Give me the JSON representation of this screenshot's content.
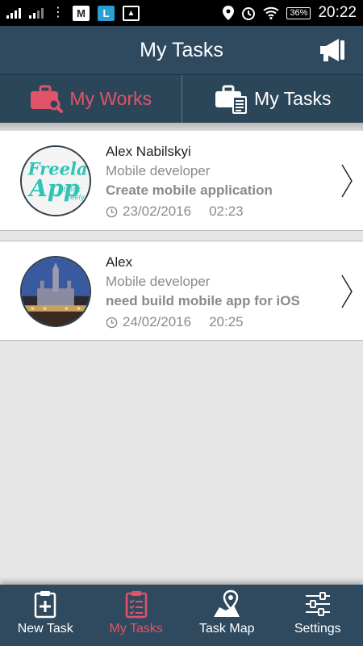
{
  "status_bar": {
    "battery": "36%",
    "time": "20:22"
  },
  "header": {
    "title": "My Tasks"
  },
  "tabs": [
    {
      "label": "My Works",
      "active": true
    },
    {
      "label": "My Tasks",
      "active": false
    }
  ],
  "tasks": [
    {
      "name": "Alex Nabilskyi",
      "role": "Mobile developer",
      "description": "Create mobile application",
      "date": "23/02/2016",
      "time": "02:23",
      "avatar_text": "Freelance App"
    },
    {
      "name": "Alex",
      "role": "Mobile developer",
      "description": "need build mobile app for iOS",
      "date": "24/02/2016",
      "time": "20:25"
    }
  ],
  "bottom_nav": [
    {
      "label": "New Task",
      "icon": "clipboard-plus-icon",
      "active": false
    },
    {
      "label": "My Tasks",
      "icon": "clipboard-list-icon",
      "active": true
    },
    {
      "label": "Task Map",
      "icon": "map-pin-icon",
      "active": false
    },
    {
      "label": "Settings",
      "icon": "sliders-icon",
      "active": false
    }
  ],
  "colors": {
    "header_bg": "#2f4a5f",
    "accent": "#e0536a",
    "list_bg": "#e6e6e6"
  }
}
